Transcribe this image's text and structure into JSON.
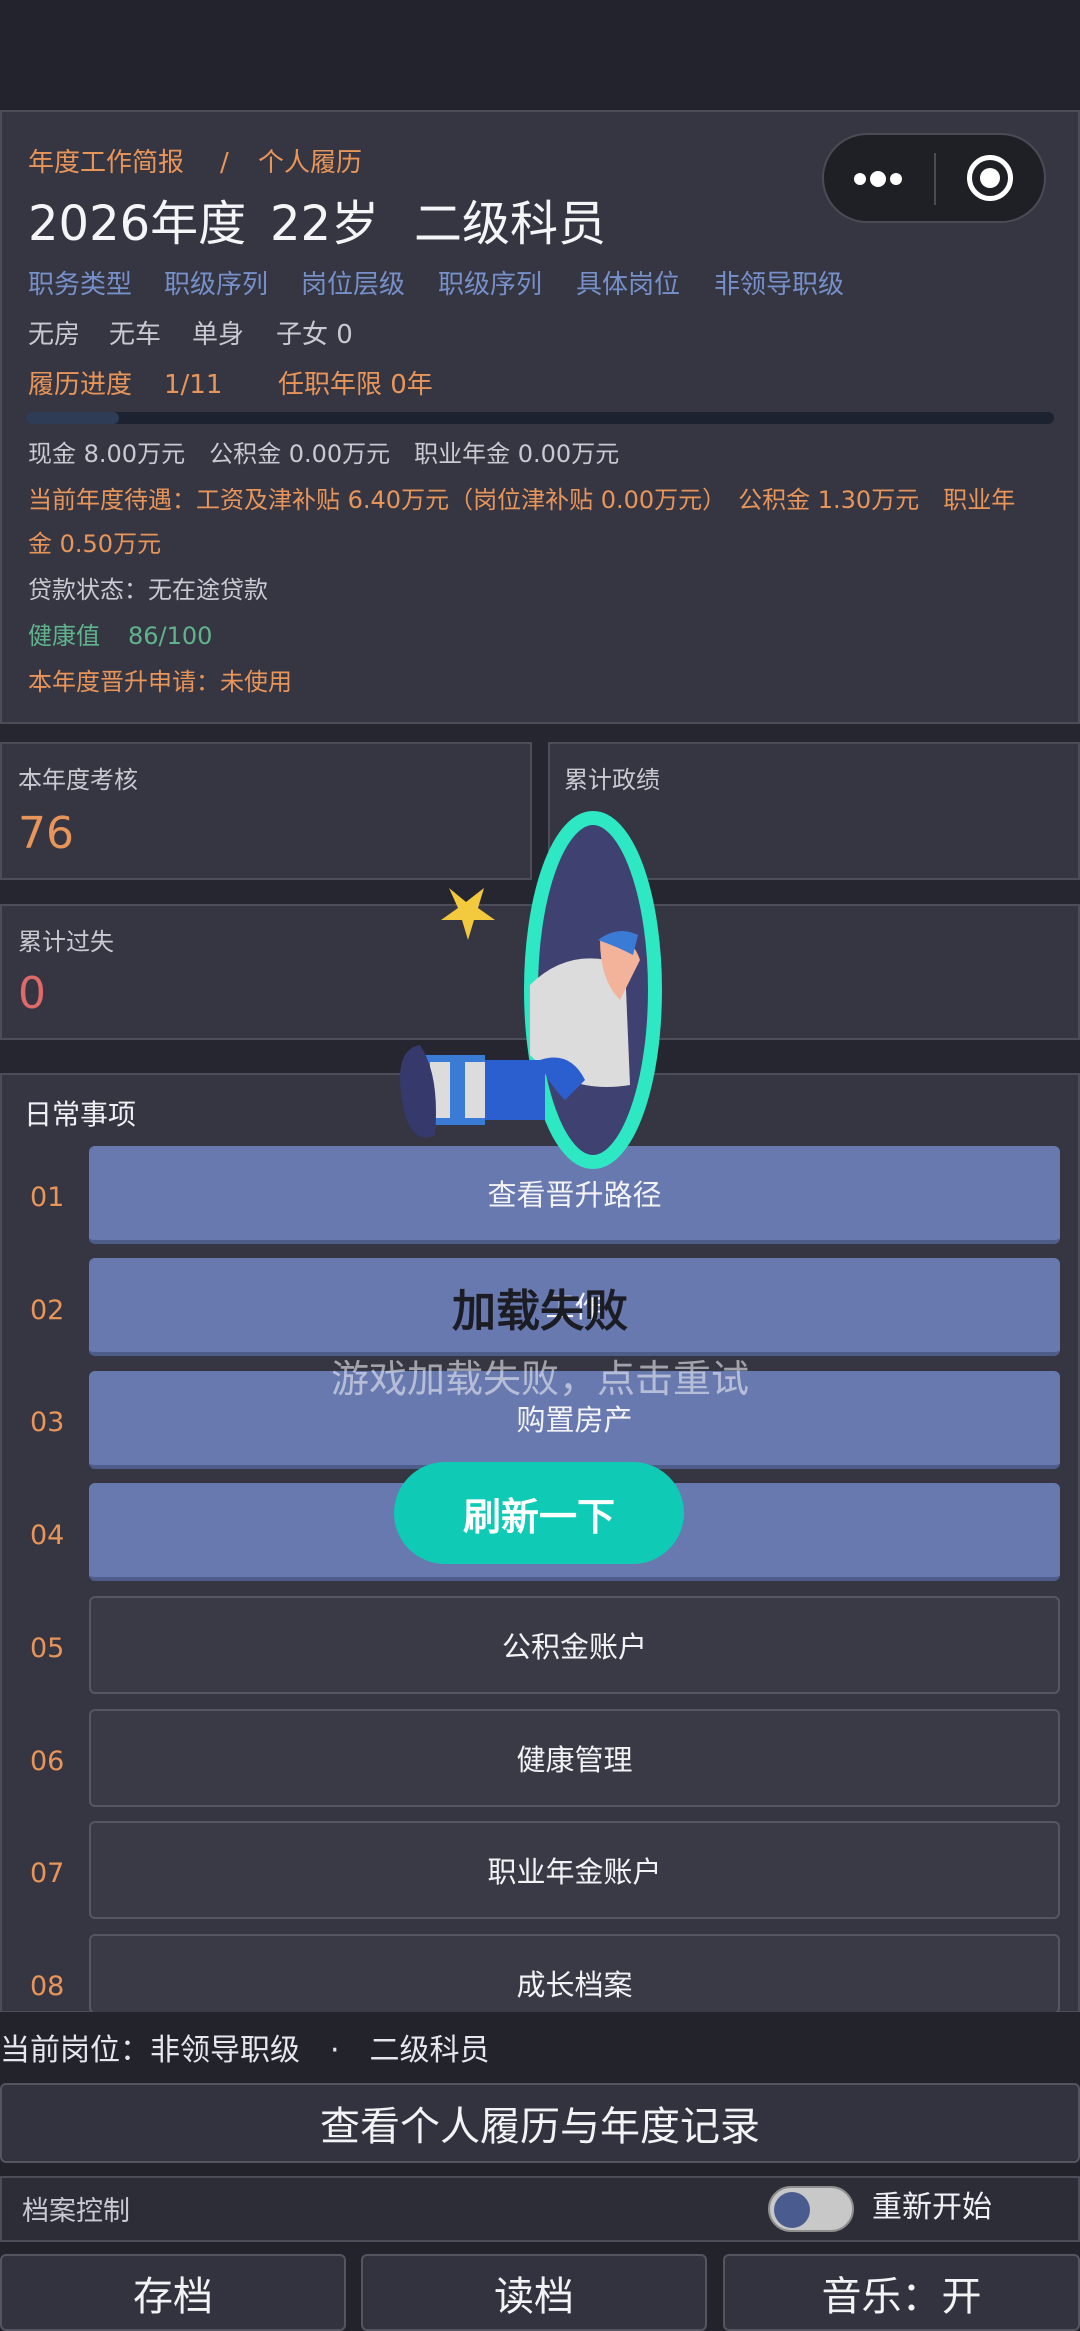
{
  "profile": {
    "breadcrumb": [
      "年度工作简报",
      "/",
      "个人履历"
    ],
    "headline": [
      "2026年度",
      "22岁",
      "二级科员"
    ],
    "tags": [
      "职务类型",
      "职级序列",
      "岗位层级",
      "职级序列",
      "具体岗位",
      "非领导职级"
    ],
    "assets": [
      "无房",
      "无车",
      "单身",
      "子女 0"
    ],
    "progress_label": "履历进度",
    "progress_value": "1/11",
    "tenure": "任职年限 0年",
    "progress_fraction": 0.09,
    "cash_line": "现金 8.00万元　公积金 0.00万元　职业年金 0.00万元",
    "salary_line1": "当前年度待遇：工资及津补贴 6.40万元（岗位津补贴 0.00万元）　公积金 1.30万元　职业年",
    "salary_line2": "金 0.50万元",
    "loan": "贷款状态：无在途贷款",
    "health_label": "健康值",
    "health_value": "86/100",
    "promotion": "本年度晋升申请：未使用"
  },
  "stats": {
    "assessment_label": "本年度考核",
    "assessment_value": "76",
    "merit_label": "累计政绩",
    "fault_label": "累计过失",
    "fault_value": "0"
  },
  "daily": {
    "title": "日常事项",
    "items": [
      {
        "num": "01",
        "label": "查看晋升路径"
      },
      {
        "num": "02",
        "label": "工作"
      },
      {
        "num": "03",
        "label": "购置房产"
      },
      {
        "num": "04",
        "label": ""
      },
      {
        "num": "05",
        "label": "公积金账户"
      },
      {
        "num": "06",
        "label": "健康管理"
      },
      {
        "num": "07",
        "label": "职业年金账户"
      },
      {
        "num": "08",
        "label": "成长档案"
      }
    ]
  },
  "footer": {
    "current_post": "当前岗位：非领导职级　·　二级科员",
    "view_record": "查看个人履历与年度记录",
    "archive_control": "档案控制",
    "restart": "重新开始",
    "save": "存档",
    "load": "读档",
    "music": "音乐：开"
  },
  "overlay": {
    "title": "加载失败",
    "subtitle": "游戏加载失败，点击重试",
    "refresh": "刷新一下"
  },
  "colors": {
    "accent_orange": "#e8955a",
    "accent_blue": "#7690c9",
    "health_green": "#5fb48c",
    "fault_red": "#e06a6a",
    "button_blue": "#6879b0",
    "refresh_teal": "#0fcab5"
  },
  "icons": [
    "more-dots-icon",
    "close-target-icon",
    "loading-failed-illustration"
  ]
}
